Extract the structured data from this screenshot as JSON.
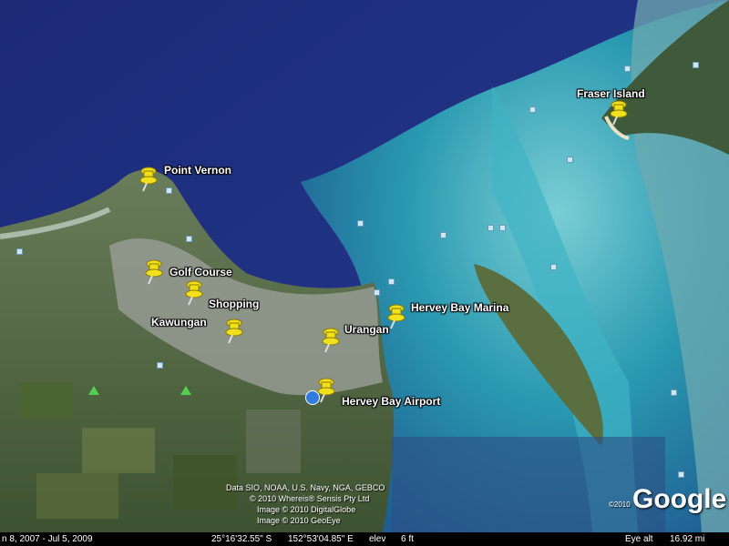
{
  "places": [
    {
      "id": "point-vernon",
      "label": "Point Vernon"
    },
    {
      "id": "golf-course",
      "label": "Golf Course"
    },
    {
      "id": "shopping",
      "label": "Shopping"
    },
    {
      "id": "kawungan",
      "label": "Kawungan"
    },
    {
      "id": "urangan",
      "label": "Urangan"
    },
    {
      "id": "hervey-bay-marina",
      "label": "Hervey Bay Marina"
    },
    {
      "id": "hervey-bay-airport",
      "label": "Hervey Bay Airport"
    },
    {
      "id": "fraser-island",
      "label": "Fraser Island"
    }
  ],
  "attribution": {
    "line1": "Data SIO, NOAA, U.S. Navy, NGA, GEBCO",
    "line2": "© 2010 Whereis® Sensis Pty Ltd",
    "line3": "Image © 2010 DigitalGlobe",
    "line4": "Image © 2010 GeoEye"
  },
  "logo": {
    "text": "Google",
    "copyright": "©2010"
  },
  "status": {
    "imagery_date": "n  8, 2007 - Jul  5, 2009",
    "latitude": "25°16'32.55\" S",
    "longitude": "152°53'04.85\" E",
    "elev_label": "elev",
    "elev_value": "6 ft",
    "eye_alt_label": "Eye alt",
    "eye_alt_value": "16.92 mi"
  },
  "colors": {
    "pin": "#f2e11a",
    "deep_water": "#24307a",
    "shallow_water": "#3aa8b8",
    "land": "#4f6b3a"
  }
}
